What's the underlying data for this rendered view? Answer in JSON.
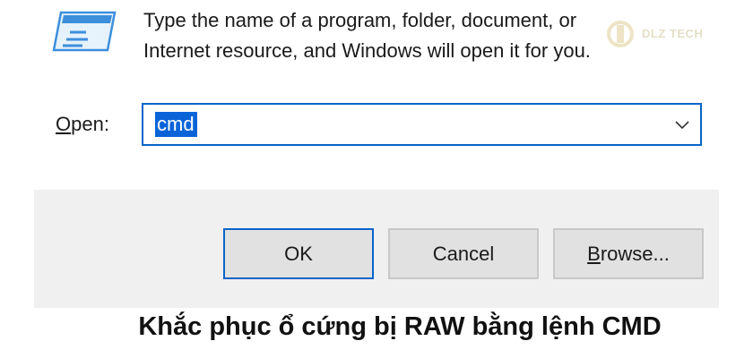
{
  "dialog": {
    "description_line1": "Type the name of a program, folder, document, or",
    "description_line2": "Internet resource, and Windows will open it for you.",
    "open_label_mnemonic": "O",
    "open_label_rest": "pen:",
    "command_value": "cmd",
    "icon": "run-icon",
    "chevron_icon": "chevron-down-icon"
  },
  "buttons": {
    "ok_label": "OK",
    "cancel_label": "Cancel",
    "browse_mnemonic": "B",
    "browse_rest": "rowse..."
  },
  "watermark": {
    "text": "DLZ TECH"
  },
  "caption": {
    "text": "Khắc phục ổ cứng bị RAW bằng lệnh CMD"
  },
  "colors": {
    "accent": "#0a64c8",
    "selection": "#0a64d8",
    "button_band": "#f0f0f0",
    "button_face": "#e1e1e1"
  }
}
